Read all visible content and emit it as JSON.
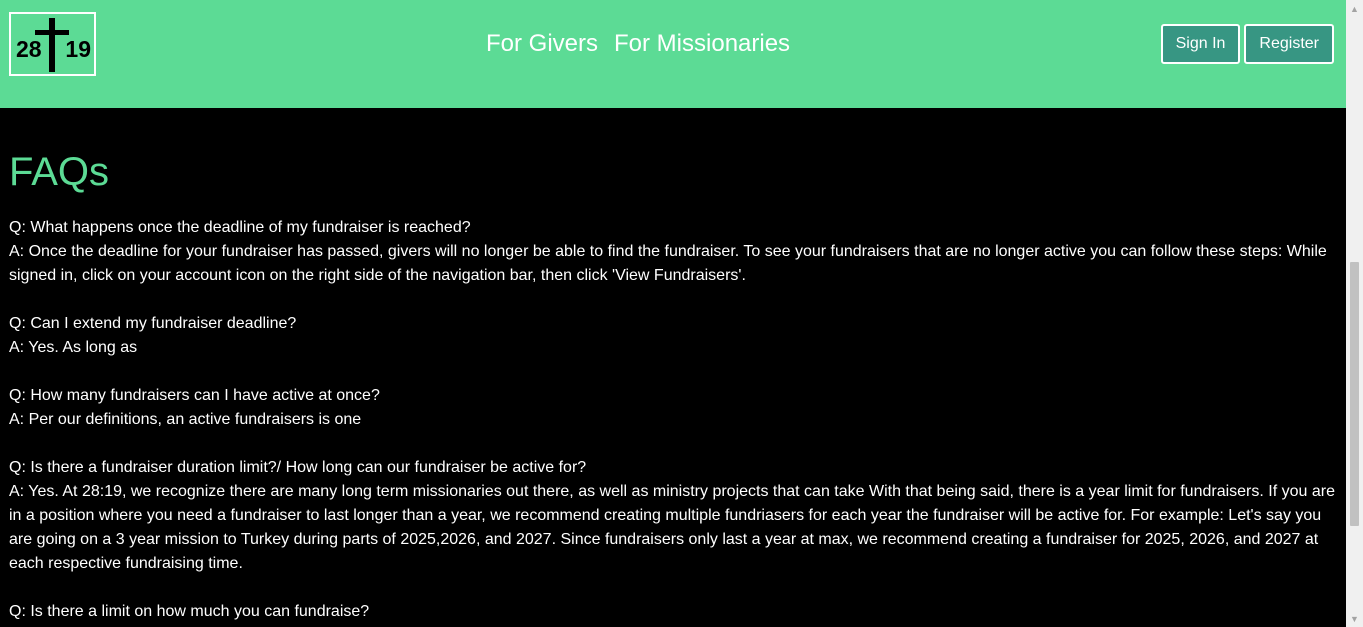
{
  "header": {
    "logo": {
      "left_text": "28",
      "right_text": "19"
    },
    "nav_links": [
      "For Givers",
      "For Missionaries"
    ],
    "sign_in_label": "Sign In",
    "register_label": "Register"
  },
  "main": {
    "title": "FAQs",
    "faqs": [
      {
        "q": "Q: What happens once the deadline of my fundraiser is reached?",
        "a": "A: Once the deadline for your fundraiser has passed, givers will no longer be able to find the fundraiser. To see your fundraisers that are no longer active you can follow these steps: While signed in, click on your account icon on the right side of the navigation bar, then click 'View Fundraisers'."
      },
      {
        "q": "Q: Can I extend my fundraiser deadline?",
        "a": "A: Yes. As long as"
      },
      {
        "q": "Q: How many fundraisers can I have active at once?",
        "a": "A: Per our definitions, an active fundraisers is one"
      },
      {
        "q": "Q: Is there a fundraiser duration limit?/ How long can our fundraiser be active for?",
        "a": "A: Yes. At 28:19, we recognize there are many long term missionaries out there, as well as ministry projects that can take With that being said, there is a year limit for fundraisers. If you are in a position where you need a fundraiser to last longer than a year, we recommend creating multiple fundriasers for each year the fundraiser will be active for. For example: Let's say you are going on a 3 year mission to Turkey during parts of 2025,2026, and 2027. Since fundraisers only last a year at max, we recommend creating a fundraiser for 2025, 2026, and 2027 at each respective fundraising time."
      },
      {
        "q": "Q: Is there a limit on how much you can fundraise?",
        "a": ""
      }
    ]
  },
  "colors": {
    "header_bg": "#5cdb95",
    "button_bg": "#379683",
    "title": "#5cdb95",
    "page_bg": "#000000"
  },
  "icons": [
    "cross-logo-icon",
    "scroll-up-arrow-icon",
    "scroll-down-arrow-icon"
  ]
}
